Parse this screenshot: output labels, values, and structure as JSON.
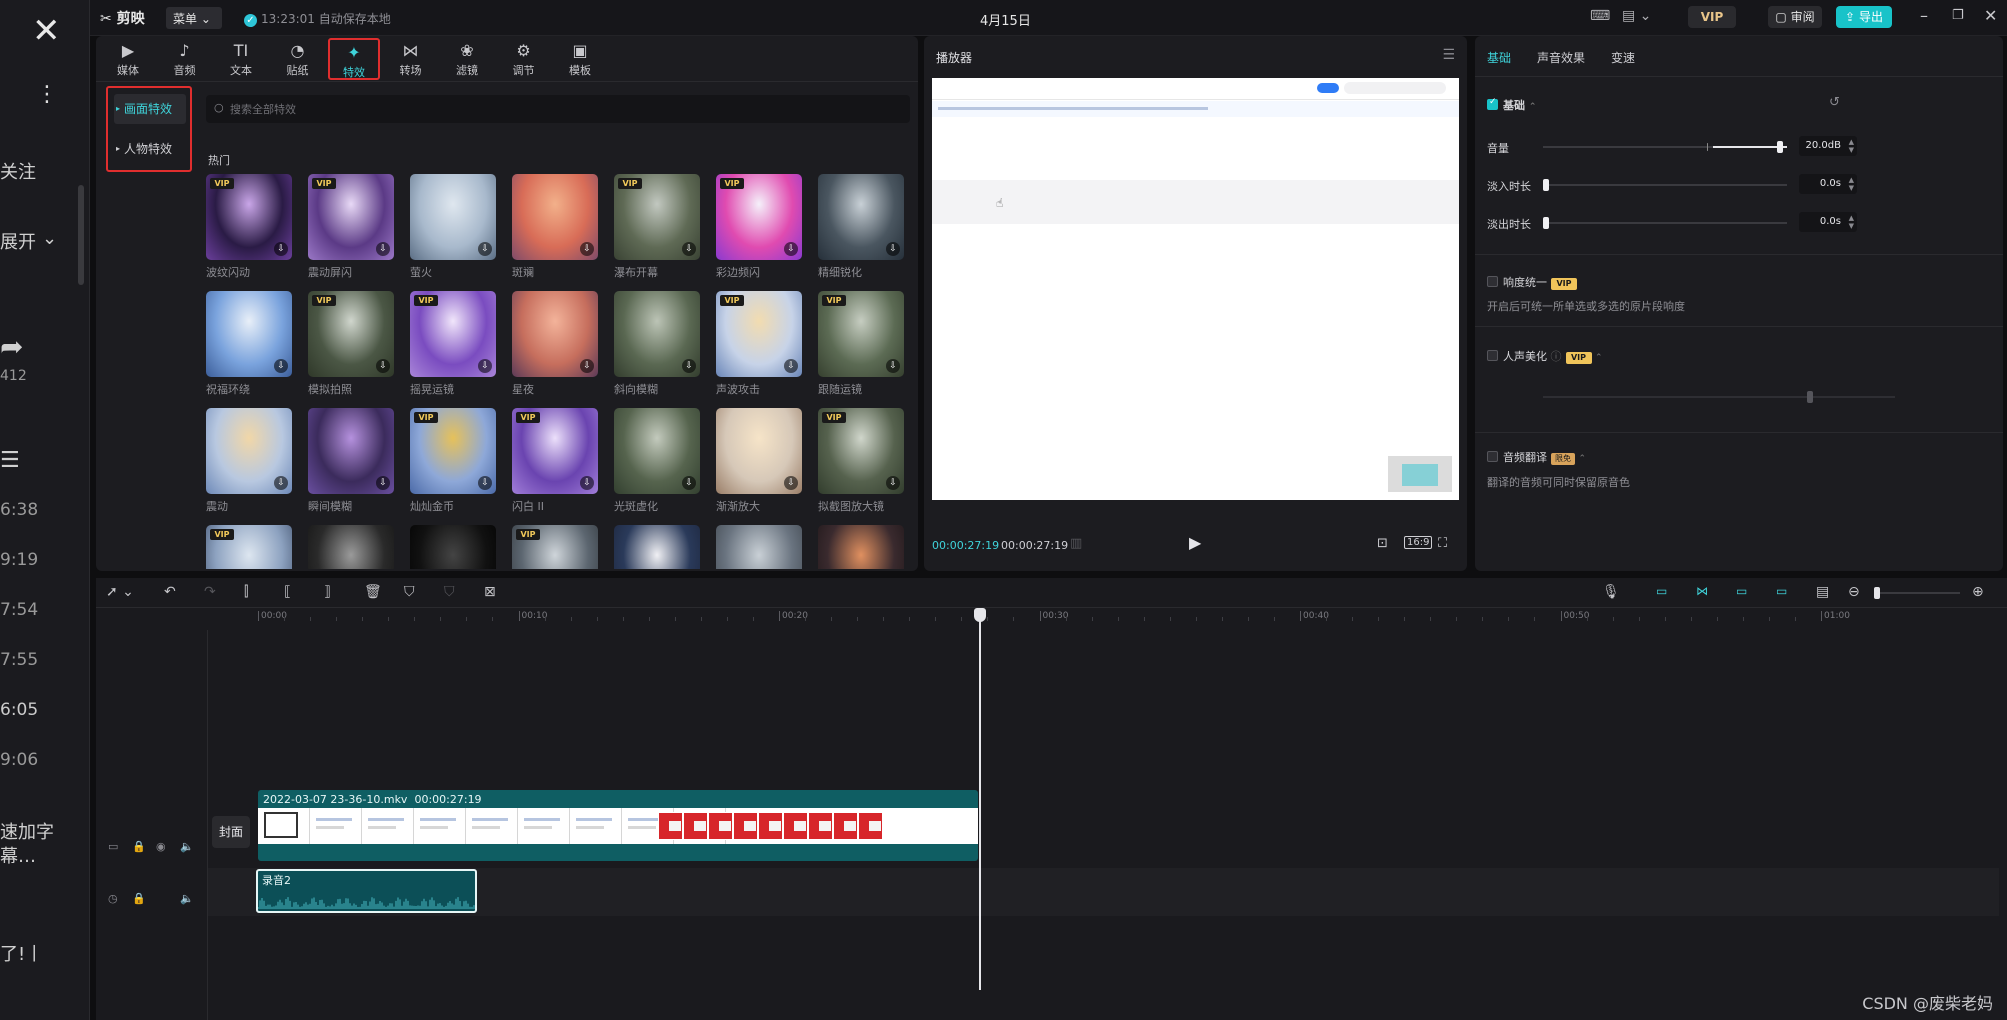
{
  "left_strip": {
    "items": [
      "关注",
      "展开",
      "412",
      "6:38",
      "9:19",
      "7:54",
      "7:55",
      "6:05",
      "9:06",
      "速加字",
      "幕…",
      "了!丨"
    ]
  },
  "titlebar": {
    "app_name": "剪映",
    "menu_label": "菜单",
    "save_status": "13:23:01 自动保存本地",
    "project_date": "4月15日",
    "vip_label": "VIP",
    "review_label": "审阅",
    "export_label": "导出"
  },
  "toolbar": {
    "tools": [
      {
        "label": "媒体",
        "icon": "▶"
      },
      {
        "label": "音频",
        "icon": "♪"
      },
      {
        "label": "文本",
        "icon": "TI"
      },
      {
        "label": "贴纸",
        "icon": "◔"
      },
      {
        "label": "特效",
        "icon": "✦"
      },
      {
        "label": "转场",
        "icon": "⋈"
      },
      {
        "label": "滤镜",
        "icon": "❀"
      },
      {
        "label": "调节",
        "icon": "⚙"
      },
      {
        "label": "模板",
        "icon": "▣"
      }
    ],
    "active_index": 4
  },
  "effects": {
    "categories": [
      {
        "label": "画面特效",
        "selected": true
      },
      {
        "label": "人物特效",
        "selected": false
      }
    ],
    "search_placeholder": "搜索全部特效",
    "section_title": "热门",
    "vip_badge": "VIP",
    "items": [
      {
        "name": "波纹闪动",
        "vip": true,
        "colors": [
          "#2a1b45",
          "#c9a6e8",
          "#6b3f9c"
        ]
      },
      {
        "name": "震动屏闪",
        "vip": true,
        "colors": [
          "#5b3a86",
          "#e8d9f6",
          "#9b78c7"
        ]
      },
      {
        "name": "萤火",
        "vip": false,
        "colors": [
          "#a8b9cc",
          "#dfe7ef",
          "#5b6e85"
        ]
      },
      {
        "name": "斑斓",
        "vip": false,
        "colors": [
          "#d86c57",
          "#f2b08a",
          "#7e4b6a"
        ]
      },
      {
        "name": "瀑布开幕",
        "vip": true,
        "colors": [
          "#5f6a55",
          "#c2c8c0",
          "#3a4334"
        ]
      },
      {
        "name": "彩边频闪",
        "vip": true,
        "colors": [
          "#e04bb0",
          "#f5f0fa",
          "#8a3ad0"
        ]
      },
      {
        "name": "精细锐化",
        "vip": false,
        "colors": [
          "#4a5660",
          "#c8d0d6",
          "#26303a"
        ]
      },
      {
        "name": "祝福环绕",
        "vip": false,
        "colors": [
          "#7aa3dd",
          "#e8eff8",
          "#3c5e9a"
        ]
      },
      {
        "name": "模拟拍照",
        "vip": true,
        "colors": [
          "#4b5745",
          "#d0d6cd",
          "#2f3829"
        ]
      },
      {
        "name": "摇晃运镜",
        "vip": true,
        "colors": [
          "#7a4cc0",
          "#f1e6fb",
          "#a985d8"
        ]
      },
      {
        "name": "星夜",
        "vip": false,
        "colors": [
          "#c66e5d",
          "#f3b39a",
          "#5c3a58"
        ]
      },
      {
        "name": "斜向模糊",
        "vip": false,
        "colors": [
          "#5a6852",
          "#bcc4b6",
          "#333d2e"
        ]
      },
      {
        "name": "声波攻击",
        "vip": true,
        "colors": [
          "#c7d3e8",
          "#f2dcb0",
          "#6a86b8"
        ]
      },
      {
        "name": "跟随运镜",
        "vip": true,
        "colors": [
          "#5c6b54",
          "#c6cdc1",
          "#36402f"
        ]
      },
      {
        "name": "震动",
        "vip": false,
        "colors": [
          "#b8c8e0",
          "#f1d7a8",
          "#6d89b8"
        ]
      },
      {
        "name": "瞬间模糊",
        "vip": false,
        "colors": [
          "#3b2b5c",
          "#b591de",
          "#6a4fa0"
        ]
      },
      {
        "name": "灿灿金币",
        "vip": true,
        "colors": [
          "#8ea8d8",
          "#e6c15a",
          "#4b6aa8"
        ]
      },
      {
        "name": "闪白 II",
        "vip": true,
        "colors": [
          "#6a44b0",
          "#ece0fb",
          "#a17ed8"
        ]
      },
      {
        "name": "光斑虚化",
        "vip": false,
        "colors": [
          "#56644e",
          "#c3cabd",
          "#334030"
        ]
      },
      {
        "name": "渐渐放大",
        "vip": false,
        "colors": [
          "#d6c8b8",
          "#f6e4c8",
          "#9a7e68"
        ]
      },
      {
        "name": "拟截图放大镜",
        "vip": true,
        "colors": [
          "#56624e",
          "#d0d6cb",
          "#323d2d"
        ]
      },
      {
        "name": "",
        "vip": true,
        "colors": [
          "#8da2c0",
          "#dde6f0",
          "#3a4a66"
        ]
      },
      {
        "name": "",
        "vip": false,
        "colors": [
          "#2a2a2a",
          "#9a9a9a",
          "#111111"
        ]
      },
      {
        "name": "",
        "vip": false,
        "colors": [
          "#111111",
          "#444444",
          "#000000"
        ]
      },
      {
        "name": "",
        "vip": true,
        "colors": [
          "#5c6670",
          "#cfd5da",
          "#2e3338"
        ]
      },
      {
        "name": "",
        "vip": false,
        "colors": [
          "#2a3a5a",
          "#f0f0f4",
          "#1a2238"
        ]
      },
      {
        "name": "",
        "vip": false,
        "colors": [
          "#6a7480",
          "#c9d0d6",
          "#3b424a"
        ]
      },
      {
        "name": "",
        "vip": false,
        "colors": [
          "#3a2a2e",
          "#e09060",
          "#1a1416"
        ]
      }
    ]
  },
  "player": {
    "title": "播放器",
    "current_time": "00:00:27:19",
    "total_time": "00:00:27:19",
    "ratio_label": "16:9"
  },
  "properties": {
    "tabs": [
      "基础",
      "声音效果",
      "变速"
    ],
    "active_tab": 0,
    "basic_label": "基础",
    "rows": [
      {
        "label": "音量",
        "value": "20.0dB",
        "level": 0.9
      },
      {
        "label": "淡入时长",
        "value": "0.0s",
        "level": 0.0
      },
      {
        "label": "淡出时长",
        "value": "0.0s",
        "level": 0.0
      }
    ],
    "loudness_label": "响度统一",
    "loudness_desc": "开启后可统一所单选或多选的原片段响度",
    "voice_beauty_label": "人声美化",
    "translate_label": "音频翻译",
    "translate_badge": "限免",
    "translate_desc": "翻译的音频可同时保留原音色"
  },
  "timeline": {
    "ticks": [
      "00:00",
      "00:10",
      "00:20",
      "00:30",
      "00:40",
      "00:50",
      "01:00"
    ],
    "cover_label": "封面",
    "video_clip_label": "2022-03-07 23-36-10.mkv",
    "video_clip_duration": "00:00:27:19",
    "audio_clip_label": "录音2"
  },
  "watermark": "CSDN @废柴老妈"
}
